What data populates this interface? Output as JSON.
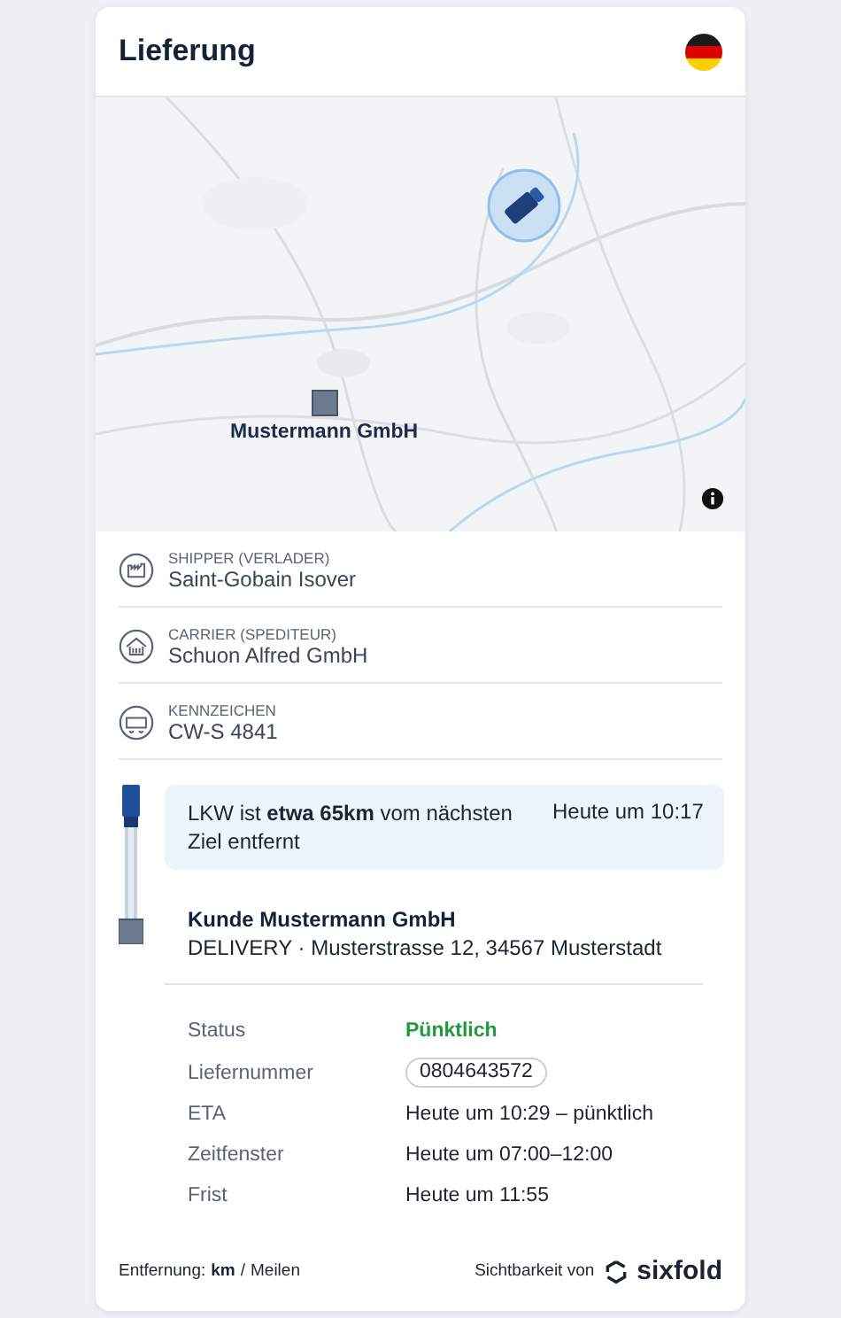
{
  "header": {
    "title": "Lieferung"
  },
  "map": {
    "kind": "picture",
    "destination_label": "Mustermann GmbH"
  },
  "parties": [
    {
      "kind": "shipper",
      "label": "SHIPPER (VERLADER)",
      "value": "Saint-Gobain Isover"
    },
    {
      "kind": "carrier",
      "label": "CARRIER (SPEDITEUR)",
      "value": "Schuon Alfred GmbH"
    },
    {
      "kind": "plate",
      "label": "KENNZEICHEN",
      "value": "CW-S 4841"
    }
  ],
  "progress": {
    "message": "LKW ist **etwa 65km** vom nächsten Ziel entfernt",
    "time": "Heute um 10:17"
  },
  "stop": {
    "name": "Kunde Mustermann GmbH",
    "address": "DELIVERY · Musterstrasse 12, 34567 Musterstadt"
  },
  "details": [
    {
      "kind": "status",
      "label": "Status",
      "value": "Pünktlich"
    },
    {
      "kind": "badge",
      "label": "Liefernummer",
      "value": "0804643572"
    },
    {
      "kind": "text",
      "label": "ETA",
      "value": "Heute um 10:29 – pünktlich"
    },
    {
      "kind": "text",
      "label": "Zeitfenster",
      "value": "Heute um 07:00–12:00"
    },
    {
      "kind": "text",
      "label": "Frist",
      "value": "Heute um 11:55"
    }
  ],
  "footer": {
    "distance_label": "Entfernung:",
    "separator": "/",
    "units": [
      {
        "label": "km",
        "selected": true
      },
      {
        "label": "Meilen",
        "selected": false
      }
    ],
    "visibility_label": "Sichtbarkeit von",
    "brand": "sixfold"
  }
}
